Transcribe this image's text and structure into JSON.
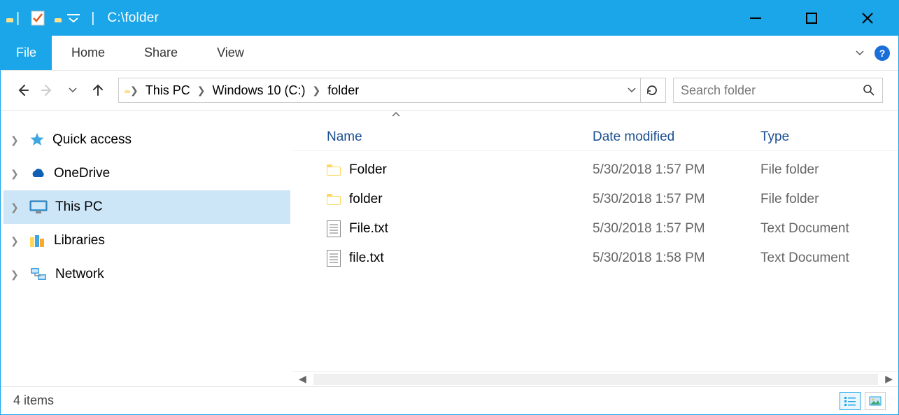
{
  "title": "C:\\folder",
  "ribbon": {
    "file": "File",
    "tabs": [
      "Home",
      "Share",
      "View"
    ]
  },
  "nav": {
    "breadcrumb": [
      "This PC",
      "Windows 10 (C:)",
      "folder"
    ],
    "search_placeholder": "Search folder"
  },
  "sidebar": {
    "items": [
      {
        "label": "Quick access",
        "icon": "star"
      },
      {
        "label": "OneDrive",
        "icon": "cloud"
      },
      {
        "label": "This PC",
        "icon": "monitor",
        "selected": true
      },
      {
        "label": "Libraries",
        "icon": "libraries"
      },
      {
        "label": "Network",
        "icon": "network"
      }
    ]
  },
  "columns": {
    "name": "Name",
    "date": "Date modified",
    "type": "Type"
  },
  "files": [
    {
      "name": "Folder",
      "date": "5/30/2018 1:57 PM",
      "type": "File folder",
      "icon": "folder"
    },
    {
      "name": "folder",
      "date": "5/30/2018 1:57 PM",
      "type": "File folder",
      "icon": "folder"
    },
    {
      "name": "File.txt",
      "date": "5/30/2018 1:57 PM",
      "type": "Text Document",
      "icon": "text"
    },
    {
      "name": "file.txt",
      "date": "5/30/2018 1:58 PM",
      "type": "Text Document",
      "icon": "text"
    }
  ],
  "status": {
    "count": "4 items"
  }
}
